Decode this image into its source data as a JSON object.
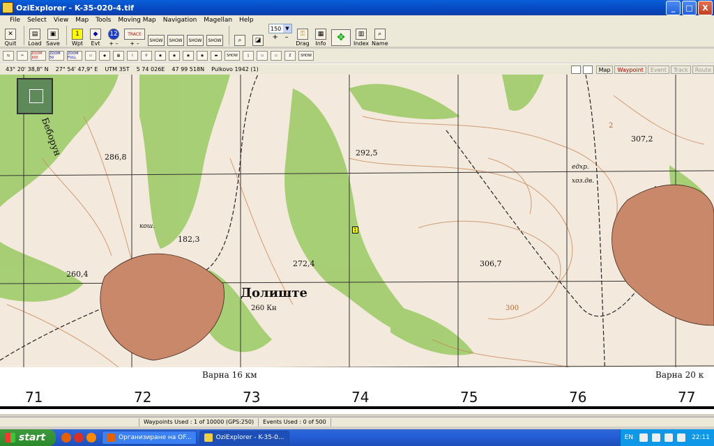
{
  "window": {
    "title": "OziExplorer - K-35-020-4.tif",
    "min_label": "_",
    "max_label": "□",
    "close_label": "X"
  },
  "menu": [
    "File",
    "Select",
    "View",
    "Map",
    "Tools",
    "Moving Map",
    "Navigation",
    "Magellan",
    "Help"
  ],
  "toolbar": {
    "quit": "Quit",
    "load": "Load",
    "save": "Save",
    "wpt": "Wpt",
    "evt": "Evt",
    "trace": "TRACE",
    "show": "SHOW",
    "zoom_value": "150",
    "drag": "Drag",
    "info": "Info",
    "index": "Index",
    "name": "Name",
    "zoom100": "ZOOM 100",
    "zoom50": "ZOOM 50",
    "zoomfull": "ZOOM FULL"
  },
  "info": {
    "lat": "43° 20' 38,8\" N",
    "lon": "27° 54' 47,9\" E",
    "utm": "UTM 35T",
    "easting": "5 74 026E",
    "northing": "47 99 518N",
    "datum": "Pulkovo 1942 (1)"
  },
  "mode_tabs": [
    "Map",
    "Waypoint",
    "Event",
    "Track",
    "Route"
  ],
  "map_labels": {
    "dolishte": "Долиште",
    "pt_292": "292,5",
    "pt_307": "307,2",
    "pt_306": "306,7",
    "pt_286": "286,8",
    "pt_272": "272,4",
    "pt_260": "260,4",
    "pt_182": "182,3",
    "h260": "260 Кн",
    "varna16": "Варна 16 км",
    "varna20": "Варна 20 к",
    "c300": "300",
    "c2": "2",
    "bor": "Беборун",
    "kosh": "кош.",
    "edhr": "едхр.",
    "hoz": "хоз.дв.",
    "waypoint_num": "1"
  },
  "grid_numbers": [
    "71",
    "72",
    "73",
    "74",
    "75",
    "76",
    "77"
  ],
  "status": {
    "waypoints": "Waypoints Used : 1 of 10000  (GPS:250)",
    "events": "Events Used : 0 of 500"
  },
  "taskbar": {
    "start": "start",
    "task1": "Организиране на OF...",
    "task2": "OziExplorer - K-35-0...",
    "lang": "EN",
    "clock": "22:11"
  }
}
